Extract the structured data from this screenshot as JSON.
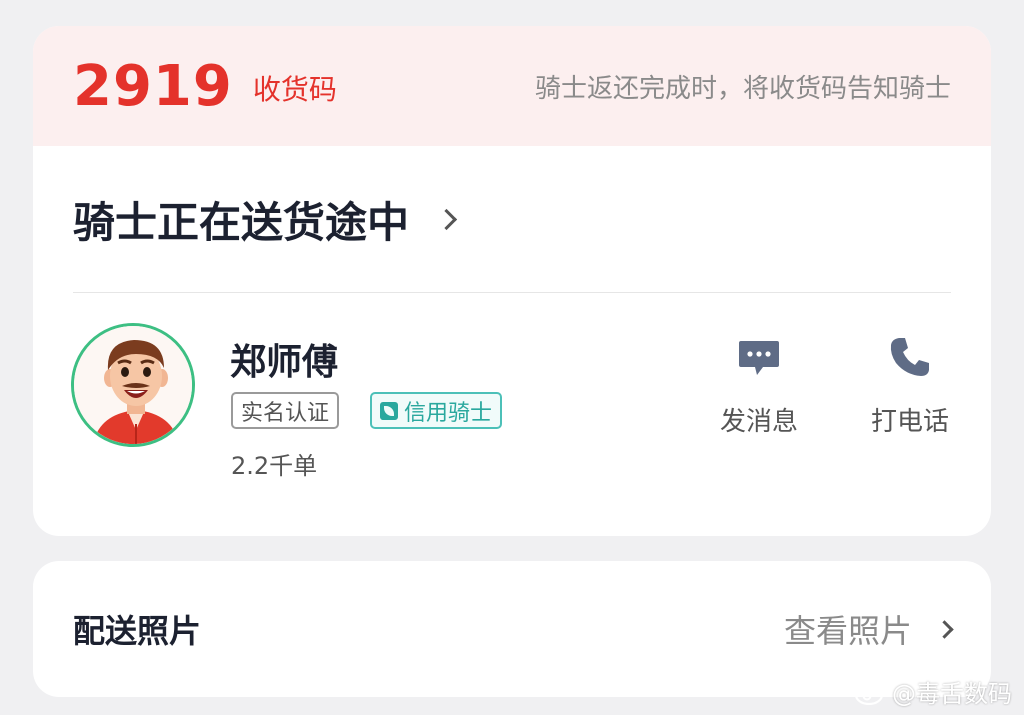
{
  "pickup": {
    "code": "2919",
    "code_label": "收货码",
    "hint": "骑士返还完成时，将收货码告知骑士"
  },
  "status": {
    "title": "骑士正在送货途中"
  },
  "rider": {
    "name": "郑师傅",
    "tags": {
      "verified": "实名认证",
      "credit": "信用骑士"
    },
    "orders": "2.2千单"
  },
  "actions": {
    "message_label": "发消息",
    "call_label": "打电话"
  },
  "photos": {
    "title": "配送照片",
    "link_label": "查看照片"
  },
  "watermark": {
    "text": "@毒舌数码"
  },
  "colors": {
    "accent_red": "#e4322b",
    "banner_bg": "#fcefef",
    "credit_teal": "#2aa89e",
    "avatar_ring": "#3dbf83",
    "icon_slate": "#5f6c86"
  }
}
